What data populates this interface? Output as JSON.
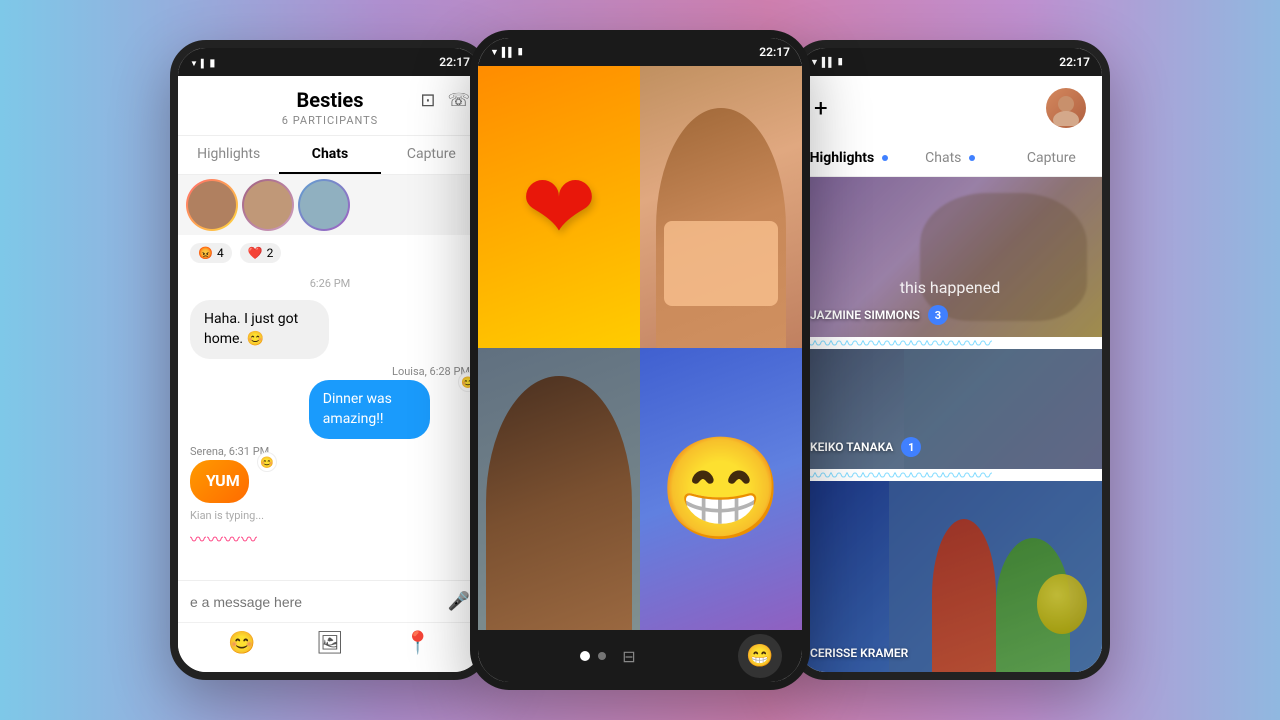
{
  "background": {
    "gradient": "linear-gradient(to right, #7ec8e8, #b090d0, #d080b0, #c090d0, #90b8e0)"
  },
  "left_phone": {
    "status_bar": {
      "time": "22:17"
    },
    "header": {
      "title": "Besties",
      "subtitle": "6 PARTICIPANTS",
      "video_icon": "□",
      "call_icon": "☏"
    },
    "tabs": [
      {
        "label": "Highlights",
        "active": false
      },
      {
        "label": "Chats",
        "active": true
      },
      {
        "label": "Capture",
        "active": false
      }
    ],
    "reactions": [
      {
        "emoji": "😡",
        "count": "4"
      },
      {
        "emoji": "❤️",
        "count": "2"
      }
    ],
    "timestamp": "6:26 PM",
    "messages": [
      {
        "type": "received",
        "text": "Haha. I just got home. 😊",
        "style": "light"
      },
      {
        "type": "sent",
        "sender": "Louisa, 6:28 PM",
        "text": "Dinner was amazing!!",
        "style": "blue",
        "reaction": "😊"
      },
      {
        "type": "sent",
        "sender": "Serena, 6:31 PM",
        "text": "YUM",
        "style": "orange",
        "reaction": "😊"
      }
    ],
    "typing": {
      "name": "Kian is typing...",
      "wave": "〰〰〰"
    },
    "input_placeholder": "e a message here",
    "bottom_icons": [
      "😊",
      "🖼",
      "📍"
    ]
  },
  "middle_phone": {
    "status_bar": {
      "time": "22:17"
    },
    "grid": [
      {
        "type": "heart",
        "bg": "orange"
      },
      {
        "type": "photo_woman1",
        "bg": "warm"
      },
      {
        "type": "photo_woman2",
        "bg": "cool"
      },
      {
        "type": "emoji_happy",
        "bg": "purple"
      }
    ],
    "bottom_bar": {
      "dots": [
        "active",
        "inactive"
      ],
      "emoji_btn": "😁"
    }
  },
  "right_phone": {
    "status_bar": {
      "time": "22:17"
    },
    "header": {
      "plus_label": "+",
      "avatar_alt": "user avatar"
    },
    "tabs": [
      {
        "label": "Highlights",
        "active": true,
        "dot": true
      },
      {
        "label": "Chats",
        "active": false,
        "dot": true
      },
      {
        "label": "Capture",
        "active": false,
        "dot": false
      }
    ],
    "highlights": [
      {
        "caption": "this happened",
        "username": "JAZMINE SIMMONS",
        "count": "3",
        "bg": "purple_warm"
      },
      {
        "caption": "",
        "username": "KEIKO TANAKA",
        "count": "1",
        "bg": "blue_cool"
      },
      {
        "caption": "",
        "username": "CERISSE KRAMER",
        "count": "",
        "bg": "blue_bright"
      }
    ]
  }
}
